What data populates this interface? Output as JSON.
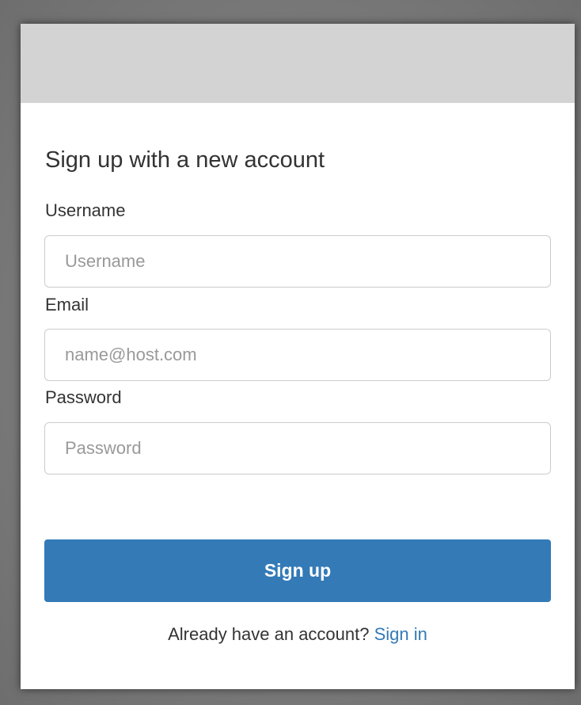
{
  "form": {
    "heading": "Sign up with a new account",
    "username": {
      "label": "Username",
      "placeholder": "Username",
      "value": ""
    },
    "email": {
      "label": "Email",
      "placeholder": "name@host.com",
      "value": ""
    },
    "password": {
      "label": "Password",
      "placeholder": "Password",
      "value": ""
    },
    "submit_label": "Sign up",
    "signin_prompt": "Already have an account?",
    "signin_link": "Sign in"
  },
  "colors": {
    "backdrop": "#7c7c7c",
    "banner": "#d3d3d3",
    "card": "#ffffff",
    "accent": "#337ab7",
    "text": "#333333",
    "placeholder": "#999999"
  }
}
